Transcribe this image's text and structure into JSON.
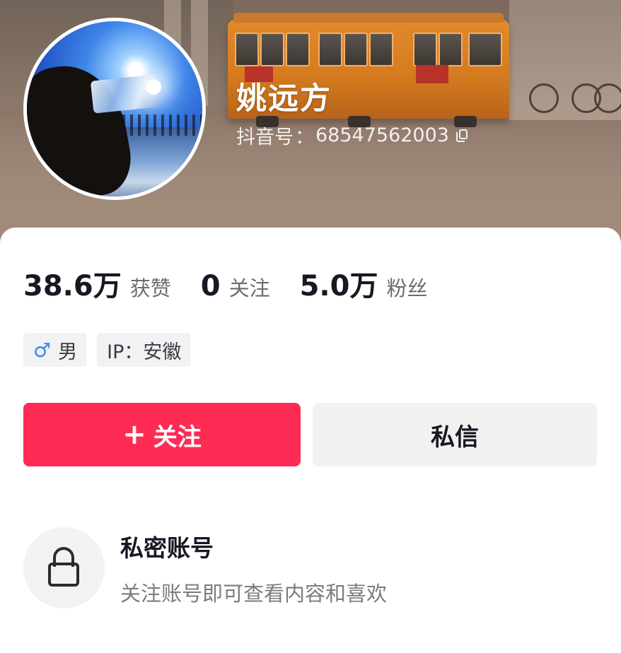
{
  "profile": {
    "username": "姚远方",
    "douyin_id_label": "抖音号",
    "douyin_id_sep": "：",
    "douyin_id": "68547562003",
    "copy_icon": "copy-icon"
  },
  "stats": [
    {
      "value": "38.6万",
      "label": "获赞"
    },
    {
      "value": "0",
      "label": "关注"
    },
    {
      "value": "5.0万",
      "label": "粉丝"
    }
  ],
  "tags": {
    "gender_symbol": "♂",
    "gender": "男",
    "ip": "IP：安徽"
  },
  "actions": {
    "follow_icon": "+",
    "follow_label": "关注",
    "message_label": "私信"
  },
  "private_account": {
    "lock_icon": "lock-icon",
    "title": "私密账号",
    "subtitle": "关注账号即可查看内容和喜欢"
  },
  "colors": {
    "follow_button": "#fe2c55",
    "message_button": "#f1f1f2",
    "male_icon": "#3a8be8"
  }
}
